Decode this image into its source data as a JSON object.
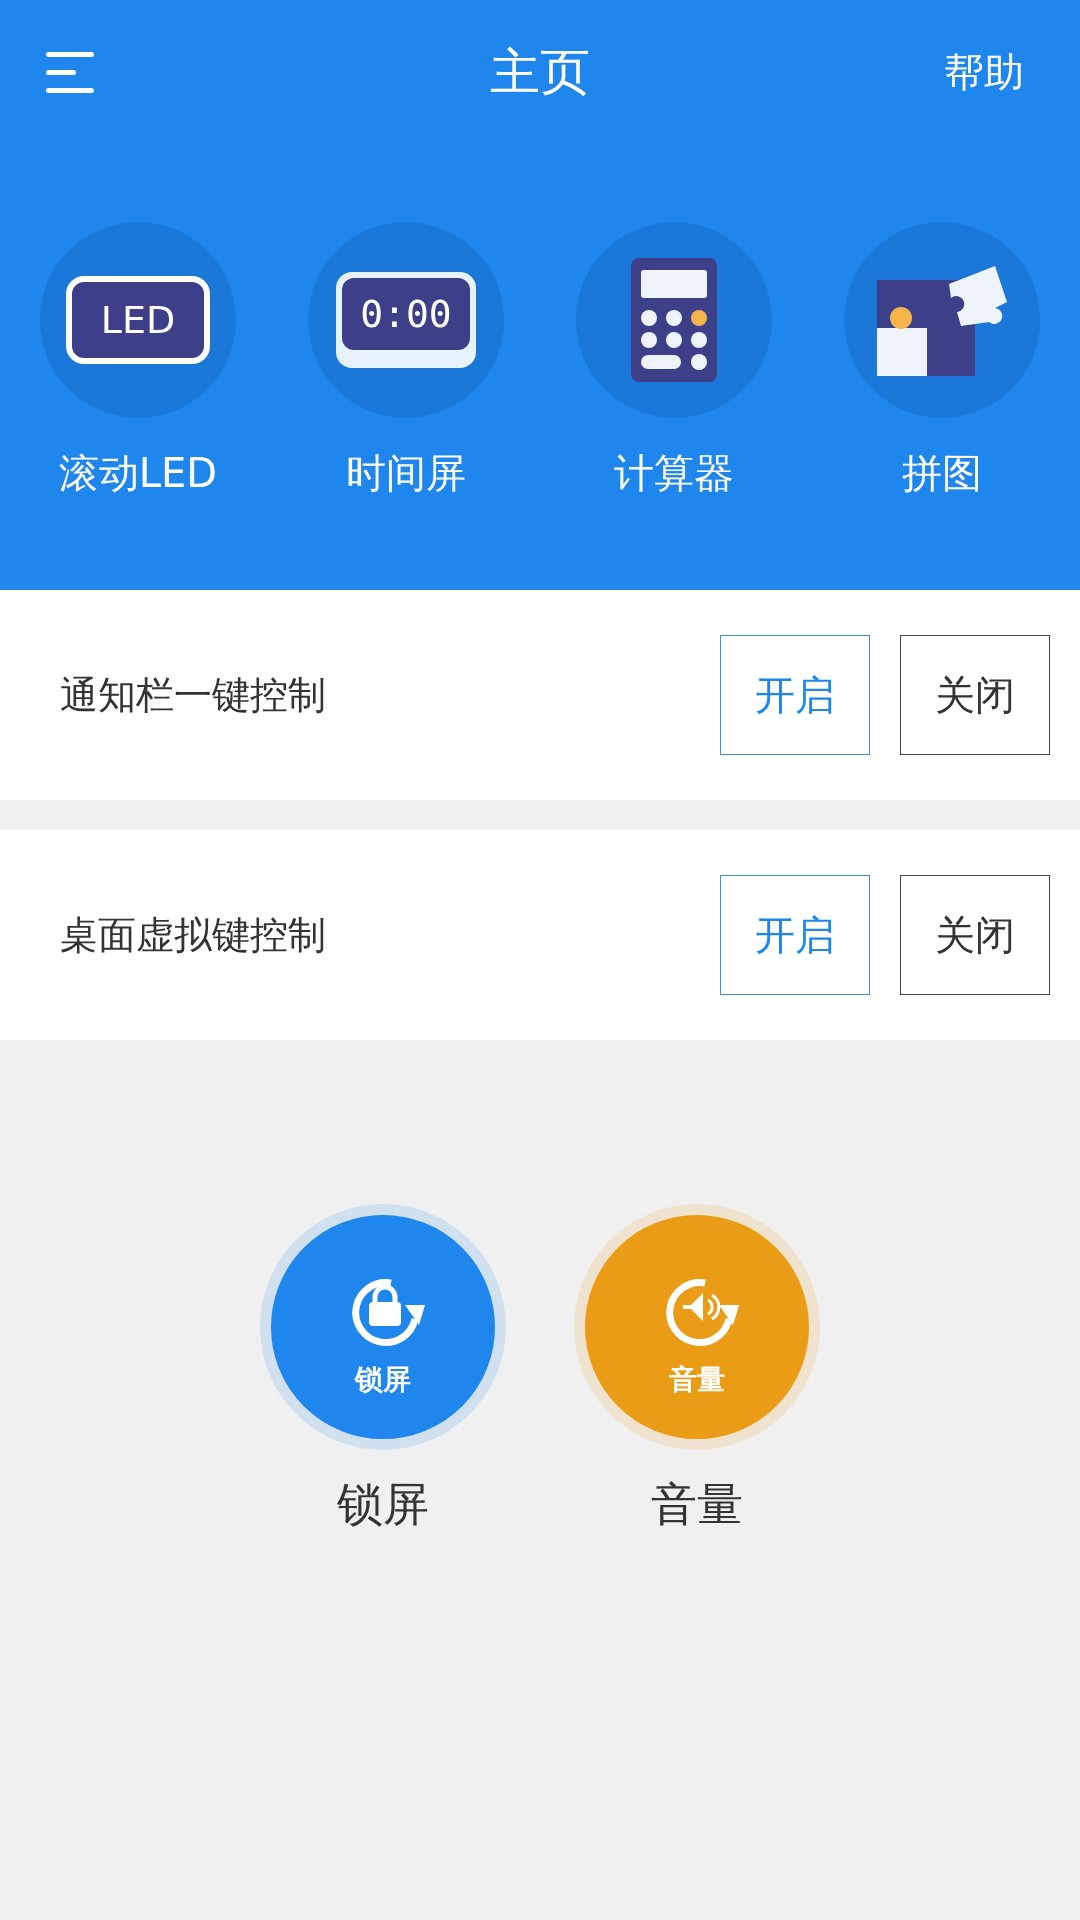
{
  "header": {
    "title": "主页",
    "action": "帮助"
  },
  "apps": [
    {
      "kind": "led",
      "icon_text": "LED",
      "label": "滚动LED"
    },
    {
      "kind": "clock",
      "icon_text": "0:00",
      "label": "时间屏"
    },
    {
      "kind": "calculator",
      "label": "计算器"
    },
    {
      "kind": "puzzle",
      "label": "拼图"
    }
  ],
  "controls": [
    {
      "label": "通知栏一键控制",
      "buttons": [
        {
          "label": "开启",
          "kind": "primary"
        },
        {
          "label": "关闭",
          "kind": "default"
        }
      ]
    },
    {
      "label": "桌面虚拟键控制",
      "buttons": [
        {
          "label": "开启",
          "kind": "primary"
        },
        {
          "label": "关闭",
          "kind": "default"
        }
      ]
    }
  ],
  "shortcuts": [
    {
      "kind": "lock",
      "icon_label": "锁屏",
      "label": "锁屏",
      "color": "#1e86ec"
    },
    {
      "kind": "volume",
      "icon_label": "音量",
      "label": "音量",
      "color": "#eb9c16"
    }
  ]
}
